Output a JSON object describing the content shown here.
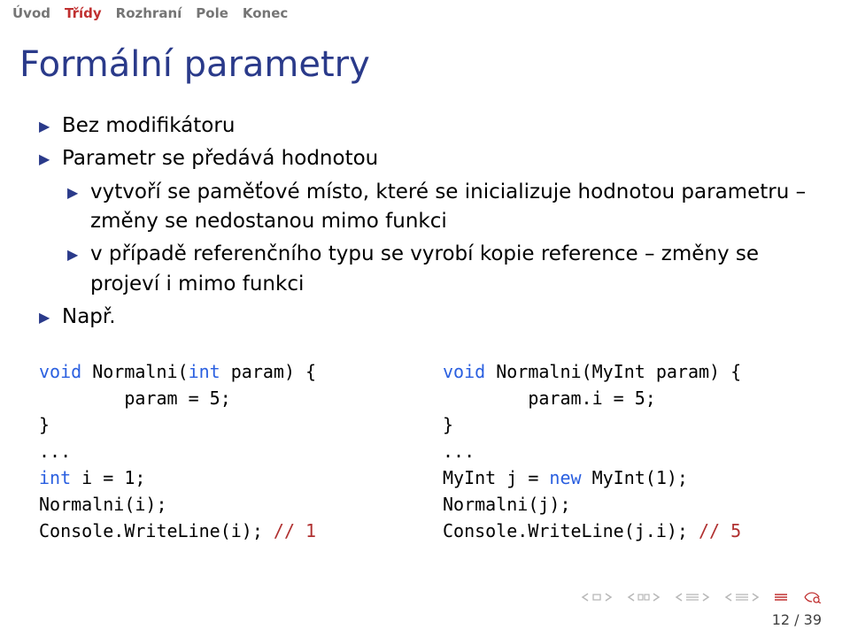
{
  "nav": {
    "items": [
      "Úvod",
      "Třídy",
      "Rozhraní",
      "Pole",
      "Konec"
    ],
    "active_index": 1
  },
  "title": "Formální parametry",
  "bullets": {
    "b1": "Bez modifikátoru",
    "b2": "Parametr se předává hodnotou",
    "b2a": "vytvoří se paměťové místo, které se inicializuje hodnotou parametru – změny se nedostanou mimo funkci",
    "b2b": "v případě referenčního typu se vyrobí kopie reference – změny se projeví i mimo funkci",
    "b3": "Např."
  },
  "code_left": {
    "l1a": "void",
    "l1b": " Normalni(",
    "l1c": "int",
    "l1d": " param) {",
    "l2": "        param = 5;",
    "l3": "}",
    "l4": "...",
    "l5a": "int",
    "l5b": " i = 1;",
    "l6": "Normalni(i);",
    "l7a": "Console.WriteLine(i); ",
    "l7b": "// 1"
  },
  "code_right": {
    "l1a": "void",
    "l1b": " Normalni(MyInt param) {",
    "l2": "        param.i = 5;",
    "l3": "}",
    "l4": "...",
    "l5a": "MyInt j = ",
    "l5b": "new",
    "l5c": " MyInt(1);",
    "l6": "Normalni(j);",
    "l7a": "Console.WriteLine(j.i); ",
    "l7b": "// 5"
  },
  "page": {
    "current": "12",
    "sep": " / ",
    "total": "39"
  }
}
